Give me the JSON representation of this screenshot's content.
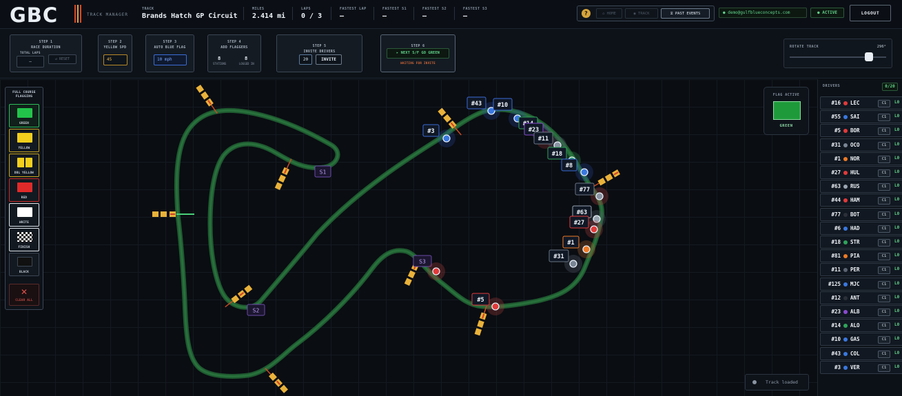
{
  "app": {
    "logo": "GBC",
    "subtitle": "TRACK MANAGER",
    "stripes": [
      "#d24a2a",
      "#e9a23b",
      "#d24a2a"
    ]
  },
  "stats": {
    "track": {
      "label": "TRACK",
      "value": "Brands Hatch GP Circuit"
    },
    "miles": {
      "label": "MILES",
      "value": "2.414 mi"
    },
    "laps": {
      "label": "LAPS",
      "value": "0 / 3"
    },
    "fastest_lap": {
      "label": "FASTEST LAP",
      "value": "—"
    },
    "fastest_s1": {
      "label": "FASTEST S1",
      "value": "—"
    },
    "fastest_s2": {
      "label": "FASTEST S2",
      "value": "—"
    },
    "fastest_s3": {
      "label": "FASTEST S3",
      "value": "—"
    }
  },
  "nav": {
    "help": "?",
    "home": "⌂ HOME",
    "track": "◉ TRACK",
    "past_events": "⧖ PAST EVENTS",
    "user": "● demo@gulfblueconcepts.com",
    "status": "● ACTIVE",
    "logout": "LOGOUT"
  },
  "steps": {
    "s1": {
      "title": "STEP 1",
      "name": "RACE DURATION",
      "sub": "TOTAL LAPS",
      "value": "—",
      "reset": "↺ RESET"
    },
    "s2": {
      "title": "STEP 2",
      "name": "YELLOW SPD",
      "value": "45"
    },
    "s3": {
      "title": "STEP 3",
      "name": "AUTO BLUE FLAG",
      "value": "10 mph"
    },
    "s4": {
      "title": "STEP 4",
      "name": "ADD FLAGGERS",
      "stations_value": "8",
      "stations_label": "STATIONS",
      "logged_value": "8",
      "logged_label": "LOGGED IN"
    },
    "s5": {
      "title": "STEP 5",
      "name": "INVITE DRIVERS",
      "value": "20",
      "button": "INVITE"
    },
    "s6": {
      "title": "STEP 6",
      "button": "▸ NEXT S/F GO GREEN",
      "note": "WAITING FOR INVITE"
    }
  },
  "rotate": {
    "label": "ROTATE TRACK",
    "value": "296°",
    "fraction": 0.82
  },
  "flags": {
    "heading_1": "FULL COURSE",
    "heading_2": "FLAGGING",
    "items": [
      {
        "label": "GREEN",
        "color": "#22c44a"
      },
      {
        "label": "YELLOW",
        "color": "#f2cf1d"
      },
      {
        "label": "DBL YELLOW",
        "color": "#f2cf1d"
      },
      {
        "label": "RED",
        "color": "#e02a2a"
      },
      {
        "label": "WHITE",
        "color": "#ffffff"
      },
      {
        "label": "FINISH",
        "color": "checker"
      },
      {
        "label": "BLACK",
        "color": "#111111"
      }
    ],
    "clear": "CLEAR ALL",
    "clear_icon": "✕"
  },
  "flag_active": {
    "label": "FLAG ACTIVE",
    "value": "GREEN",
    "color": "#1f9a3b"
  },
  "track_status": "Track loaded",
  "sectors": [
    "S1",
    "S2",
    "S3"
  ],
  "track_labels": [
    "#43",
    "#10",
    "#3",
    "#14",
    "#23",
    "#11",
    "#18",
    "#8",
    "#77",
    "#63",
    "#27",
    "#1",
    "#31",
    "#5"
  ],
  "drivers": {
    "label": "DRIVERS",
    "count": "0/20",
    "list": [
      {
        "num": "#16",
        "code": "LEC",
        "color": "#e23a3a",
        "cls": "C1",
        "lap": "L0"
      },
      {
        "num": "#55",
        "code": "SAI",
        "color": "#3a78e0",
        "cls": "C1",
        "lap": "L0"
      },
      {
        "num": "#5",
        "code": "BOR",
        "color": "#e23a3a",
        "cls": "C1",
        "lap": "L0"
      },
      {
        "num": "#31",
        "code": "OCO",
        "color": "#7a8594",
        "cls": "C1",
        "lap": "L0"
      },
      {
        "num": "#1",
        "code": "NOR",
        "color": "#ee7a25",
        "cls": "C1",
        "lap": "L0"
      },
      {
        "num": "#27",
        "code": "HUL",
        "color": "#e23a3a",
        "cls": "C1",
        "lap": "L0"
      },
      {
        "num": "#63",
        "code": "RUS",
        "color": "#9aa5b2",
        "cls": "C1",
        "lap": "L0"
      },
      {
        "num": "#44",
        "code": "HAM",
        "color": "#e23a3a",
        "cls": "C1",
        "lap": "L0"
      },
      {
        "num": "#77",
        "code": "BOT",
        "color": "#2b3038",
        "cls": "C1",
        "lap": "L0"
      },
      {
        "num": "#6",
        "code": "HAD",
        "color": "#3a78e0",
        "cls": "C1",
        "lap": "L0"
      },
      {
        "num": "#18",
        "code": "STR",
        "color": "#2fa35a",
        "cls": "C1",
        "lap": "L0"
      },
      {
        "num": "#81",
        "code": "PIA",
        "color": "#ee7a25",
        "cls": "C1",
        "lap": "L0"
      },
      {
        "num": "#11",
        "code": "PER",
        "color": "#5a6472",
        "cls": "C1",
        "lap": "L0"
      },
      {
        "num": "#125",
        "code": "MJC",
        "color": "#3a78e0",
        "cls": "C1",
        "lap": "L0"
      },
      {
        "num": "#12",
        "code": "ANT",
        "color": "#2b3038",
        "cls": "C1",
        "lap": "L0"
      },
      {
        "num": "#23",
        "code": "ALB",
        "color": "#8a4ad0",
        "cls": "C1",
        "lap": "L0"
      },
      {
        "num": "#14",
        "code": "ALO",
        "color": "#2fa35a",
        "cls": "C1",
        "lap": "L0"
      },
      {
        "num": "#10",
        "code": "GAS",
        "color": "#3a78e0",
        "cls": "C1",
        "lap": "L0"
      },
      {
        "num": "#43",
        "code": "COL",
        "color": "#3a78e0",
        "cls": "C1",
        "lap": "L0"
      },
      {
        "num": "#3",
        "code": "VER",
        "color": "#3a78e0",
        "cls": "C1",
        "lap": "L0"
      }
    ]
  }
}
